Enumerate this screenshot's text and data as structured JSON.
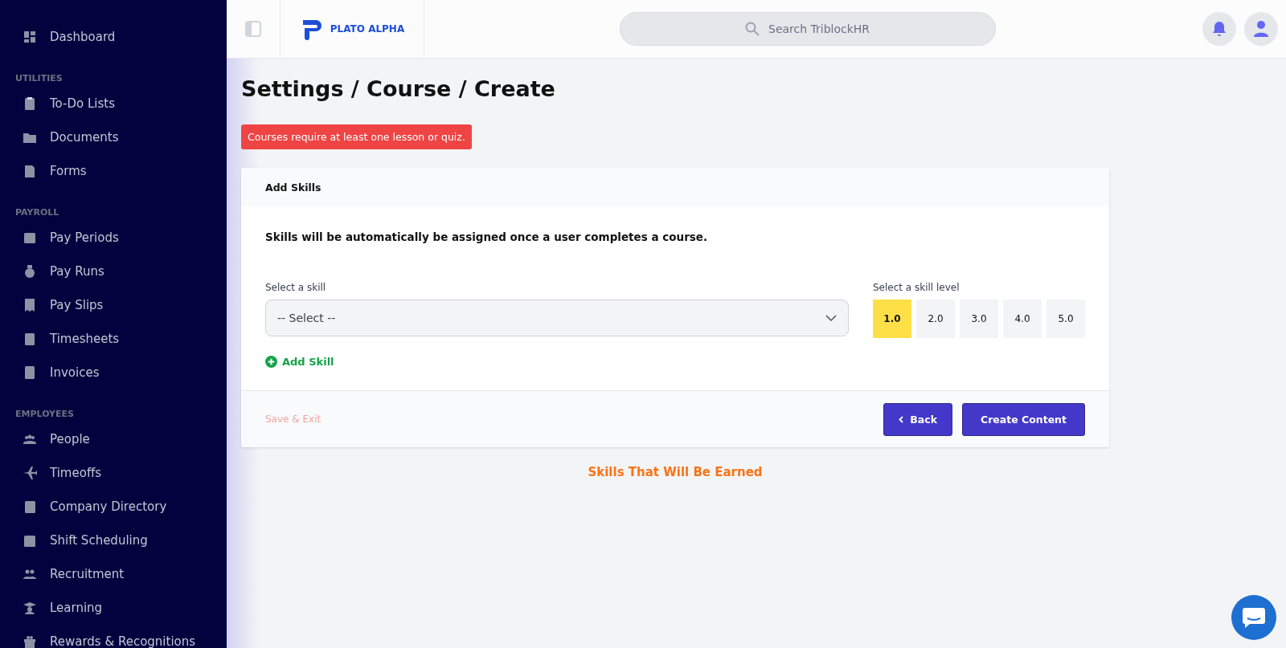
{
  "sidebar": {
    "sections": [
      {
        "items": [
          {
            "label": "Dashboard"
          }
        ]
      },
      {
        "title": "UTILITIES",
        "items": [
          {
            "label": "To-Do Lists"
          },
          {
            "label": "Documents"
          },
          {
            "label": "Forms"
          }
        ]
      },
      {
        "title": "PAYROLL",
        "items": [
          {
            "label": "Pay Periods"
          },
          {
            "label": "Pay Runs"
          },
          {
            "label": "Pay Slips"
          },
          {
            "label": "Timesheets"
          },
          {
            "label": "Invoices"
          }
        ]
      },
      {
        "title": "EMPLOYEES",
        "items": [
          {
            "label": "People"
          },
          {
            "label": "Timeoffs"
          },
          {
            "label": "Company Directory"
          },
          {
            "label": "Shift Scheduling"
          },
          {
            "label": "Recruitment"
          },
          {
            "label": "Learning"
          },
          {
            "label": "Rewards & Recognitions"
          }
        ]
      }
    ]
  },
  "topbar": {
    "logo": "PLATO ALPHA",
    "search": {
      "placeholder": "Search TriblockHR"
    }
  },
  "page": {
    "title": "Settings / Course / Create",
    "alert": "Courses require at least one lesson or quiz.",
    "card": {
      "header": "Add Skills",
      "description": "Skills will be automatically be assigned once a user completes a course.",
      "skill_field": {
        "label": "Select a skill",
        "value": "-- Select --"
      },
      "level_label": "Select a skill level",
      "levels": [
        {
          "label": "1.0",
          "selected": true
        },
        {
          "label": "2.0",
          "selected": false
        },
        {
          "label": "3.0",
          "selected": false
        },
        {
          "label": "4.0",
          "selected": false
        },
        {
          "label": "5.0",
          "selected": false
        }
      ],
      "add_skill": "Add Skill",
      "save_exit": "Save & Exit",
      "back": "Back",
      "create": "Create Content"
    },
    "earned_heading": "Skills That Will Be Earned"
  }
}
